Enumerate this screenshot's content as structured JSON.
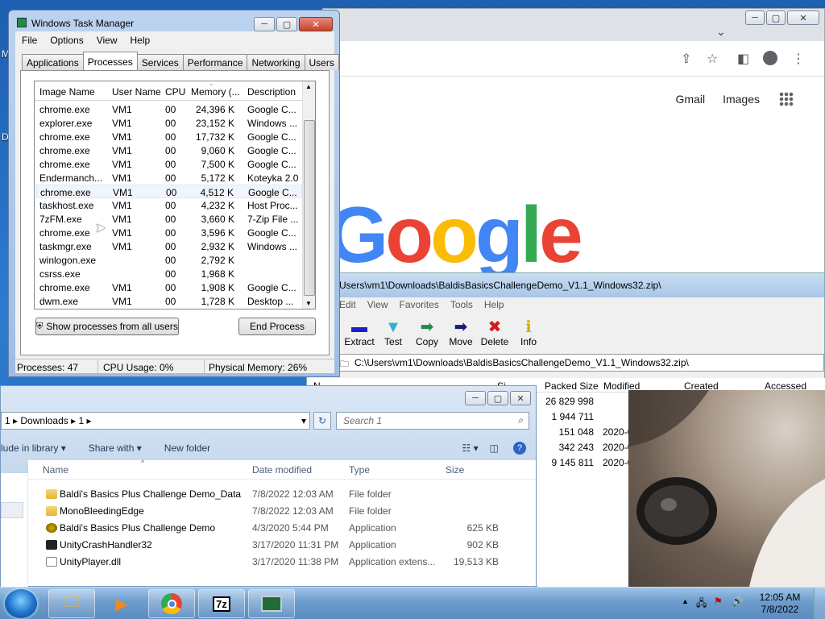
{
  "desktop": {
    "letters": [
      "M",
      "D"
    ]
  },
  "chrome": {
    "links": [
      "Gmail",
      "Images"
    ],
    "logo": "Google",
    "logo_colors": [
      "#4285F4",
      "#EA4335",
      "#FBBC05",
      "#4285F4",
      "#34A853",
      "#EA4335"
    ]
  },
  "sevenzip": {
    "title": "C:\\Users\\vm1\\Downloads\\BaldisBasicsChallengeDemo_V1.1_Windows32.zip\\",
    "title_visible": "Users\\vm1\\Downloads\\BaldisBasicsChallengeDemo_V1.1_Windows32.zip\\",
    "menu": [
      "Edit",
      "View",
      "Favorites",
      "Tools",
      "Help"
    ],
    "toolbar": [
      {
        "label": "Extract",
        "icon": "minus-icon",
        "glyph": "▬",
        "color": "#1d1dcc"
      },
      {
        "label": "Test",
        "icon": "test-icon",
        "glyph": "▼",
        "color": "#2ab3c9"
      },
      {
        "label": "Copy",
        "icon": "copy-arrow-icon",
        "glyph": "➡",
        "color": "#1f8a4c"
      },
      {
        "label": "Move",
        "icon": "move-arrow-icon",
        "glyph": "➡",
        "color": "#1a1a7a"
      },
      {
        "label": "Delete",
        "icon": "delete-x-icon",
        "glyph": "✖",
        "color": "#d11a1a"
      },
      {
        "label": "Info",
        "icon": "info-icon",
        "glyph": "ℹ",
        "color": "#d4b000"
      }
    ],
    "path": "C:\\Users\\vm1\\Downloads\\BaldisBasicsChallengeDemo_V1.1_Windows32.zip\\",
    "columns": [
      "Packed Size",
      "Modified",
      "Created",
      "Accessed"
    ],
    "rows": [
      {
        "packed": "26 829 998",
        "modified": ""
      },
      {
        "packed": "1 944 711",
        "modified": ""
      },
      {
        "packed": "151 048",
        "modified": "2020-0"
      },
      {
        "packed": "342 243",
        "modified": "2020-0"
      },
      {
        "packed": "9 145 811",
        "modified": "2020-0"
      }
    ]
  },
  "explorer": {
    "breadcrumb": [
      "1",
      "Downloads",
      "1"
    ],
    "search_placeholder": "Search 1",
    "commands": [
      "lude in library",
      "Share with",
      "New folder"
    ],
    "columns": [
      "Name",
      "Date modified",
      "Type",
      "Size"
    ],
    "files": [
      {
        "name": "Baldi's Basics Plus Challenge Demo_Data",
        "date": "7/8/2022 12:03 AM",
        "type": "File folder",
        "size": "",
        "icon": "folder-icon"
      },
      {
        "name": "MonoBleedingEdge",
        "date": "7/8/2022 12:03 AM",
        "type": "File folder",
        "size": "",
        "icon": "folder-icon"
      },
      {
        "name": "Baldi's Basics Plus Challenge Demo",
        "date": "4/3/2020 5:44 PM",
        "type": "Application",
        "size": "625 KB",
        "icon": "app-icon"
      },
      {
        "name": "UnityCrashHandler32",
        "date": "3/17/2020 11:31 PM",
        "type": "Application",
        "size": "902 KB",
        "icon": "unity-icon"
      },
      {
        "name": "UnityPlayer.dll",
        "date": "3/17/2020 11:38 PM",
        "type": "Application extens...",
        "size": "19,513 KB",
        "icon": "dll-icon"
      }
    ]
  },
  "taskmgr": {
    "title": "Windows Task Manager",
    "menu": [
      "File",
      "Options",
      "View",
      "Help"
    ],
    "tabs": [
      "Applications",
      "Processes",
      "Services",
      "Performance",
      "Networking",
      "Users"
    ],
    "active_tab": "Processes",
    "columns": [
      "Image Name",
      "User Name",
      "CPU",
      "Memory (...",
      "Description"
    ],
    "processes": [
      {
        "name": "chrome.exe",
        "user": "VM1",
        "cpu": "00",
        "mem": "24,396 K",
        "desc": "Google C..."
      },
      {
        "name": "explorer.exe",
        "user": "VM1",
        "cpu": "00",
        "mem": "23,152 K",
        "desc": "Windows ..."
      },
      {
        "name": "chrome.exe",
        "user": "VM1",
        "cpu": "00",
        "mem": "17,732 K",
        "desc": "Google C..."
      },
      {
        "name": "chrome.exe",
        "user": "VM1",
        "cpu": "00",
        "mem": "9,060 K",
        "desc": "Google C..."
      },
      {
        "name": "chrome.exe",
        "user": "VM1",
        "cpu": "00",
        "mem": "7,500 K",
        "desc": "Google C..."
      },
      {
        "name": "Endermanch...",
        "user": "VM1",
        "cpu": "00",
        "mem": "5,172 K",
        "desc": "Koteyka 2.0"
      },
      {
        "name": "chrome.exe",
        "user": "VM1",
        "cpu": "00",
        "mem": "4,512 K",
        "desc": "Google C..."
      },
      {
        "name": "taskhost.exe",
        "user": "VM1",
        "cpu": "00",
        "mem": "4,232 K",
        "desc": "Host Proc..."
      },
      {
        "name": "7zFM.exe",
        "user": "VM1",
        "cpu": "00",
        "mem": "3,660 K",
        "desc": "7-Zip File ..."
      },
      {
        "name": "chrome.exe",
        "user": "VM1",
        "cpu": "00",
        "mem": "3,596 K",
        "desc": "Google C..."
      },
      {
        "name": "taskmgr.exe",
        "user": "VM1",
        "cpu": "00",
        "mem": "2,932 K",
        "desc": "Windows ..."
      },
      {
        "name": "winlogon.exe",
        "user": "",
        "cpu": "00",
        "mem": "2,792 K",
        "desc": ""
      },
      {
        "name": "csrss.exe",
        "user": "",
        "cpu": "00",
        "mem": "1,968 K",
        "desc": ""
      },
      {
        "name": "chrome.exe",
        "user": "VM1",
        "cpu": "00",
        "mem": "1,908 K",
        "desc": "Google C..."
      },
      {
        "name": "dwm.exe",
        "user": "VM1",
        "cpu": "00",
        "mem": "1,728 K",
        "desc": "Desktop ..."
      }
    ],
    "selected_row": 6,
    "show_all_label": "Show processes from all users",
    "end_process_label": "End Process",
    "status": {
      "processes": "Processes: 47",
      "cpu": "CPU Usage: 0%",
      "memory": "Physical Memory: 26%"
    }
  },
  "taskbar": {
    "apps": [
      "explorer-icon",
      "media-player-icon",
      "chrome-icon",
      "7zip-icon",
      "taskmgr-icon"
    ],
    "time": "12:05 AM",
    "date": "7/8/2022"
  }
}
